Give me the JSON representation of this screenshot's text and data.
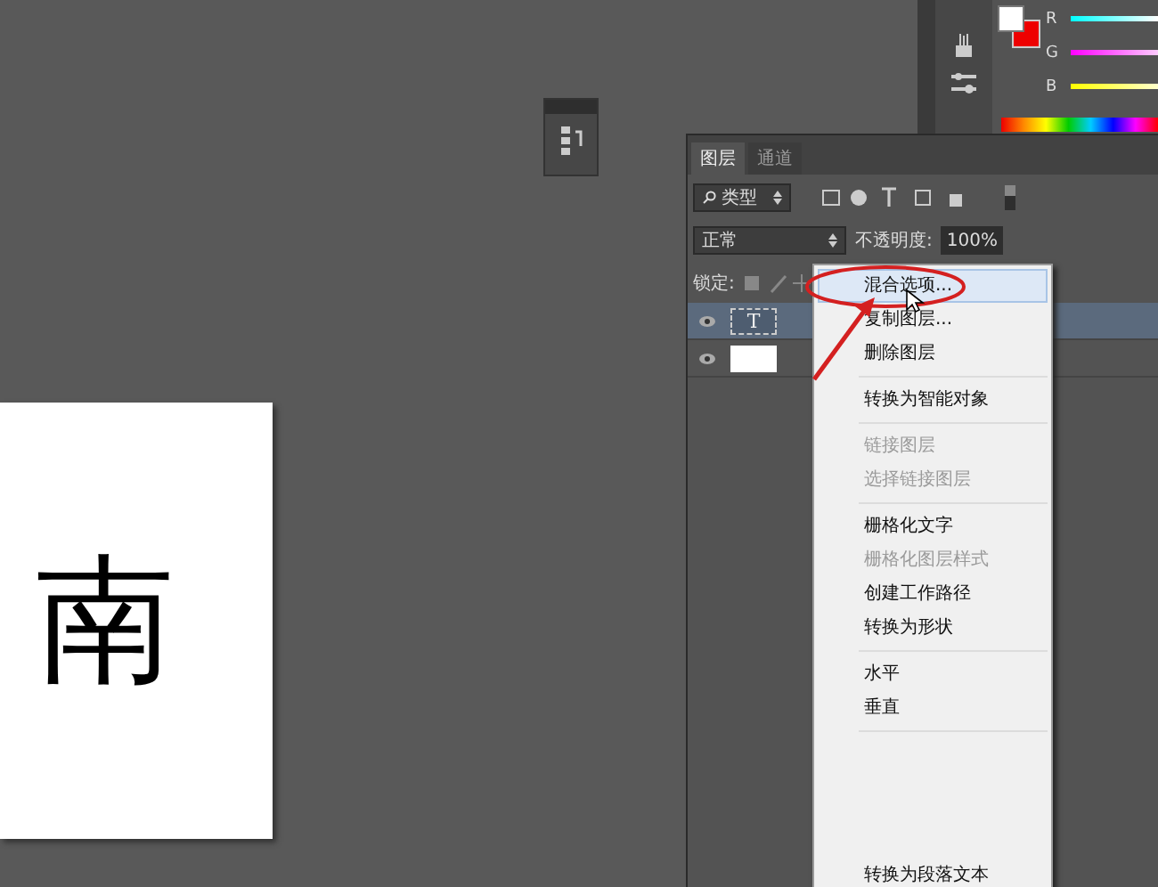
{
  "color_panel": {
    "channels": [
      {
        "label": "R"
      },
      {
        "label": "G"
      },
      {
        "label": "B"
      }
    ]
  },
  "document": {
    "text": "南"
  },
  "layers_panel": {
    "tabs": [
      {
        "label": "图层",
        "selected": true
      },
      {
        "label": "通道",
        "selected": false
      }
    ],
    "filter": {
      "value": "类型"
    },
    "blend_mode": {
      "value": "正常"
    },
    "opacity": {
      "label": "不透明度:",
      "value": "100%"
    },
    "lock": {
      "label": "锁定:"
    },
    "layers": [
      {
        "kind": "text",
        "selected": true,
        "thumb_text": "T"
      },
      {
        "kind": "fill",
        "selected": false
      }
    ]
  },
  "context_menu": {
    "items": [
      {
        "kind": "item",
        "label": "混合选项...",
        "selected": true,
        "disabled": false
      },
      {
        "kind": "item",
        "label": "复制图层...",
        "selected": false,
        "disabled": false
      },
      {
        "kind": "item",
        "label": "删除图层",
        "selected": false,
        "disabled": false
      },
      {
        "kind": "separator"
      },
      {
        "kind": "item",
        "label": "转换为智能对象",
        "selected": false,
        "disabled": false
      },
      {
        "kind": "separator"
      },
      {
        "kind": "item",
        "label": "链接图层",
        "selected": false,
        "disabled": true
      },
      {
        "kind": "item",
        "label": "选择链接图层",
        "selected": false,
        "disabled": true
      },
      {
        "kind": "separator"
      },
      {
        "kind": "item",
        "label": "栅格化文字",
        "selected": false,
        "disabled": false
      },
      {
        "kind": "item",
        "label": "栅格化图层样式",
        "selected": false,
        "disabled": true
      },
      {
        "kind": "item",
        "label": "创建工作路径",
        "selected": false,
        "disabled": false
      },
      {
        "kind": "item",
        "label": "转换为形状",
        "selected": false,
        "disabled": false
      },
      {
        "kind": "separator"
      },
      {
        "kind": "item",
        "label": "水平",
        "selected": false,
        "disabled": false
      },
      {
        "kind": "item",
        "label": "垂直",
        "selected": false,
        "disabled": false
      },
      {
        "kind": "separator"
      },
      {
        "kind": "blank"
      },
      {
        "kind": "item",
        "label": "转换为段落文本",
        "selected": false,
        "disabled": false
      }
    ]
  }
}
